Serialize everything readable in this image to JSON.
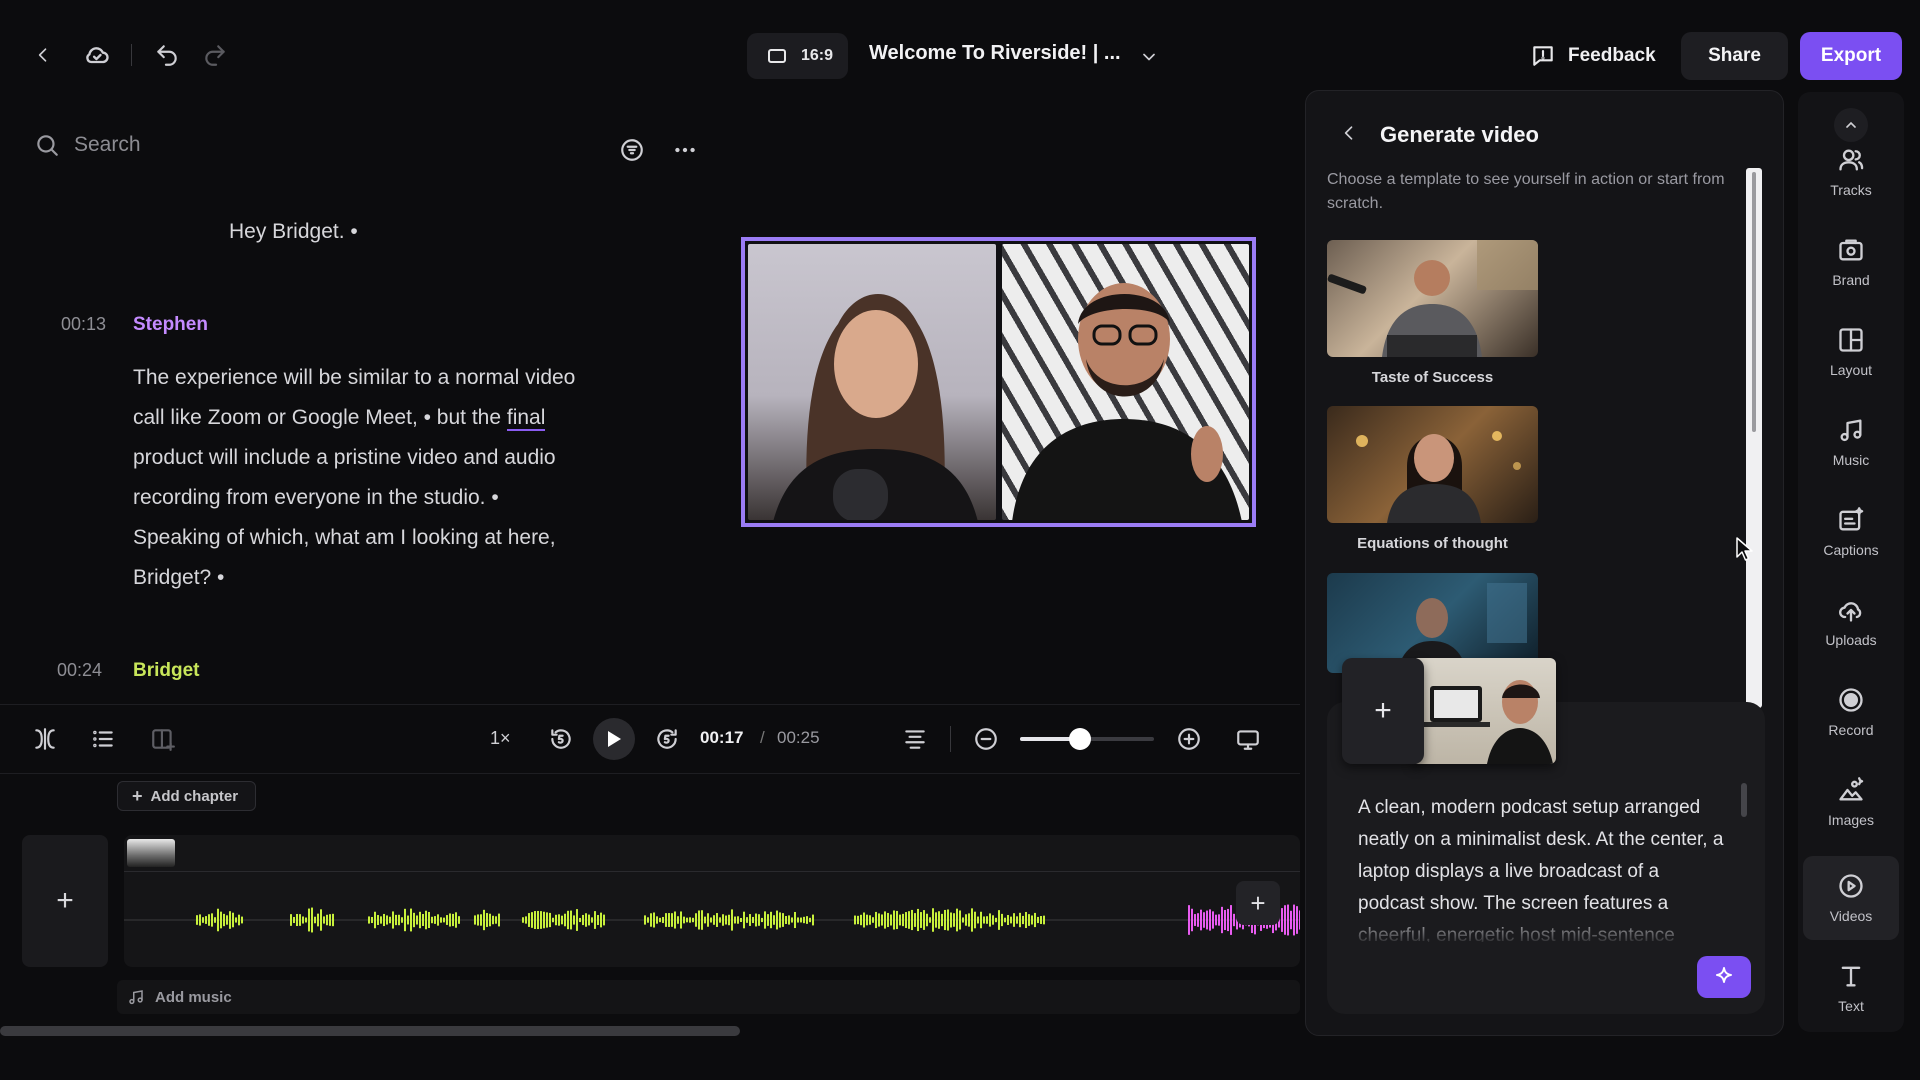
{
  "header": {
    "aspect_ratio": "16:9",
    "project_title": "Welcome To Riverside! | ...",
    "feedback_label": "Feedback",
    "share_label": "Share",
    "export_label": "Export"
  },
  "transcript": {
    "search_placeholder": "Search",
    "intro_line": "Hey Bridget. •",
    "segments": [
      {
        "time": "00:13",
        "speaker": "Stephen",
        "lines": [
          "The experience will be similar to a normal video",
          "call like Zoom or Google Meet, • but the",
          "final",
          "product will include a pristine video and audio",
          "recording from everyone in the studio. •",
          "Speaking of which, what am I looking at here,",
          "Bridget? •"
        ]
      },
      {
        "time": "00:24",
        "speaker": "Bridget"
      }
    ]
  },
  "playback": {
    "speed": "1×",
    "current_time": "00:17",
    "separator": "/",
    "total_time": "00:25",
    "zoom_level": 0.45
  },
  "timeline": {
    "add_chapter_label": "Add chapter",
    "add_music_label": "Add music"
  },
  "generate_panel": {
    "title": "Generate video",
    "subtitle": "Choose a template to see yourself in action or start from scratch.",
    "templates": [
      {
        "label": "Taste of Success"
      },
      {
        "label": "Equations of thought"
      },
      {
        "label": ""
      }
    ],
    "prompt_text": "A clean, modern podcast setup arranged neatly on a minimalist desk. At the center, a laptop displays a live broadcast of a podcast show. The screen features a cheerful, energetic host mid-sentence"
  },
  "sidebar": {
    "items": [
      {
        "label": "Tracks",
        "icon": "users-icon"
      },
      {
        "label": "Brand",
        "icon": "brand-icon"
      },
      {
        "label": "Layout",
        "icon": "layout-icon"
      },
      {
        "label": "Music",
        "icon": "music-icon"
      },
      {
        "label": "Captions",
        "icon": "captions-icon"
      },
      {
        "label": "Uploads",
        "icon": "upload-icon"
      },
      {
        "label": "Record",
        "icon": "record-icon"
      },
      {
        "label": "Images",
        "icon": "images-icon"
      },
      {
        "label": "Videos",
        "icon": "video-icon"
      },
      {
        "label": "Text",
        "icon": "text-icon"
      }
    ]
  },
  "colors": {
    "accent": "#7b4ff2",
    "stephen": "#c48bff",
    "bridget": "#c8e65a",
    "waveform": "#c8f03c",
    "waveform_alt": "#e85cf0"
  }
}
